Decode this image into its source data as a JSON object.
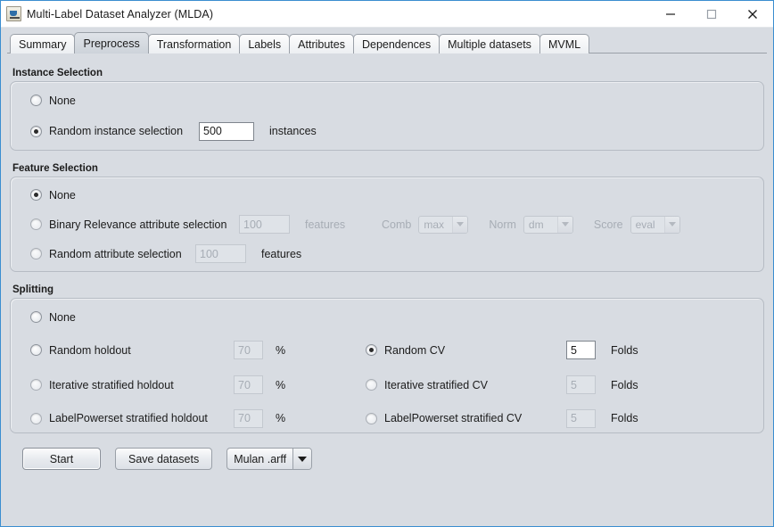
{
  "window": {
    "title": "Multi-Label Dataset Analyzer (MLDA)",
    "app_icon": "java-coffee-cup-icon",
    "minimize_label": "—",
    "maximize_label": "□",
    "close_label": "✕",
    "border_color": "#3b8ed0",
    "background_color": "#d8dce2"
  },
  "tabs": [
    {
      "label": "Summary",
      "selected": false
    },
    {
      "label": "Preprocess",
      "selected": true
    },
    {
      "label": "Transformation",
      "selected": false
    },
    {
      "label": "Labels",
      "selected": false
    },
    {
      "label": "Attributes",
      "selected": false
    },
    {
      "label": "Dependences",
      "selected": false
    },
    {
      "label": "Multiple datasets",
      "selected": false
    },
    {
      "label": "MVML",
      "selected": false
    }
  ],
  "instance_selection": {
    "title": "Instance Selection",
    "options": [
      {
        "label": "None",
        "selected": false
      },
      {
        "label": "Random instance selection",
        "selected": true
      }
    ],
    "instances_value": "500",
    "instances_unit": "instances"
  },
  "feature_selection": {
    "title": "Feature Selection",
    "options": [
      {
        "label": "None",
        "selected": true
      },
      {
        "label": "Binary Relevance attribute selection",
        "selected": false
      },
      {
        "label": "Random attribute selection",
        "selected": false
      }
    ],
    "br_features_value": "100",
    "br_features_unit": "features",
    "random_features_value": "100",
    "random_features_unit": "features",
    "comb_label": "Comb",
    "comb_value": "max",
    "norm_label": "Norm",
    "norm_value": "dm",
    "score_label": "Score",
    "score_value": "eval"
  },
  "splitting": {
    "title": "Splitting",
    "left": [
      {
        "label": "None",
        "selected": false,
        "value": null,
        "unit": null
      },
      {
        "label": "Random holdout",
        "selected": false,
        "value": "70",
        "unit": "%"
      },
      {
        "label": "Iterative stratified holdout",
        "selected": false,
        "value": "70",
        "unit": "%"
      },
      {
        "label": "LabelPowerset stratified holdout",
        "selected": false,
        "value": "70",
        "unit": "%"
      }
    ],
    "right": [
      {
        "label": "Random CV",
        "selected": true,
        "value": "5",
        "unit": "Folds"
      },
      {
        "label": "Iterative stratified CV",
        "selected": false,
        "value": "5",
        "unit": "Folds"
      },
      {
        "label": "LabelPowerset stratified CV",
        "selected": false,
        "value": "5",
        "unit": "Folds"
      }
    ]
  },
  "bottom": {
    "start_label": "Start",
    "save_label": "Save datasets",
    "format_value": "Mulan .arff"
  }
}
